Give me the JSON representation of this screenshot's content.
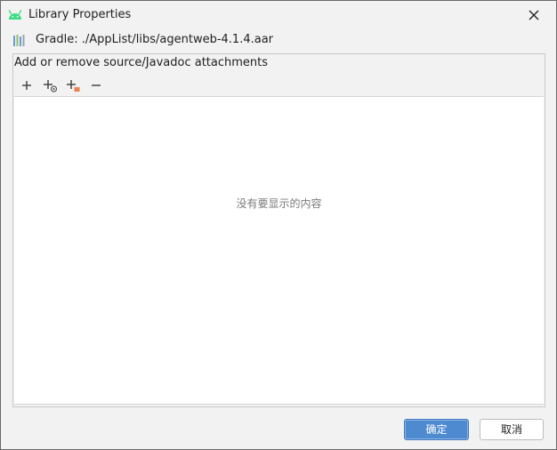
{
  "window": {
    "title": "Library Properties",
    "app_icon": "android-icon",
    "close_icon": "close-icon"
  },
  "library": {
    "icon": "gradle-library-icon",
    "path": "Gradle: ./AppList/libs/agentweb-4.1.4.aar"
  },
  "attachments": {
    "header": "Add or remove source/Javadoc attachments",
    "toolbar": [
      {
        "icon": "add-icon"
      },
      {
        "icon": "add-source-icon"
      },
      {
        "icon": "add-folder-icon"
      },
      {
        "icon": "remove-icon"
      }
    ],
    "empty_text": "没有要显示的内容"
  },
  "buttons": {
    "ok_label": "确定",
    "cancel_label": "取消"
  },
  "colors": {
    "android_green": "#3ddc84",
    "accent_blue": "#4d8ad0",
    "folder_orange": "#e8834d"
  }
}
